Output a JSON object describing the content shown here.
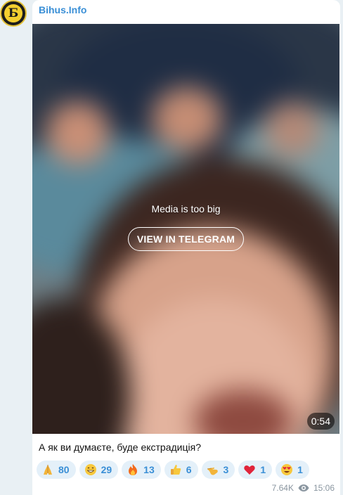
{
  "channel": {
    "name": "Bihus.Info",
    "avatar_letter": "Б"
  },
  "media": {
    "message": "Media is too big",
    "button_label": "VIEW IN TELEGRAM",
    "duration": "0:54"
  },
  "caption": "А як ви думаєте, буде екстрадиція?",
  "reactions": [
    {
      "icon": "folded-hands-emoji",
      "count": "80"
    },
    {
      "icon": "grinning-face-emoji",
      "count": "29"
    },
    {
      "icon": "fire-emoji",
      "count": "13"
    },
    {
      "icon": "thumbs-up-emoji",
      "count": "6"
    },
    {
      "icon": "pointing-hand-emoji",
      "count": "3"
    },
    {
      "icon": "red-heart-emoji",
      "count": "1"
    },
    {
      "icon": "heart-eyes-emoji",
      "count": "1"
    }
  ],
  "meta": {
    "views": "7.64K",
    "time": "15:06"
  },
  "colors": {
    "link": "#3a8fd6",
    "reaction_bg": "#e4f0f9",
    "meta_text": "#8a96a0"
  }
}
